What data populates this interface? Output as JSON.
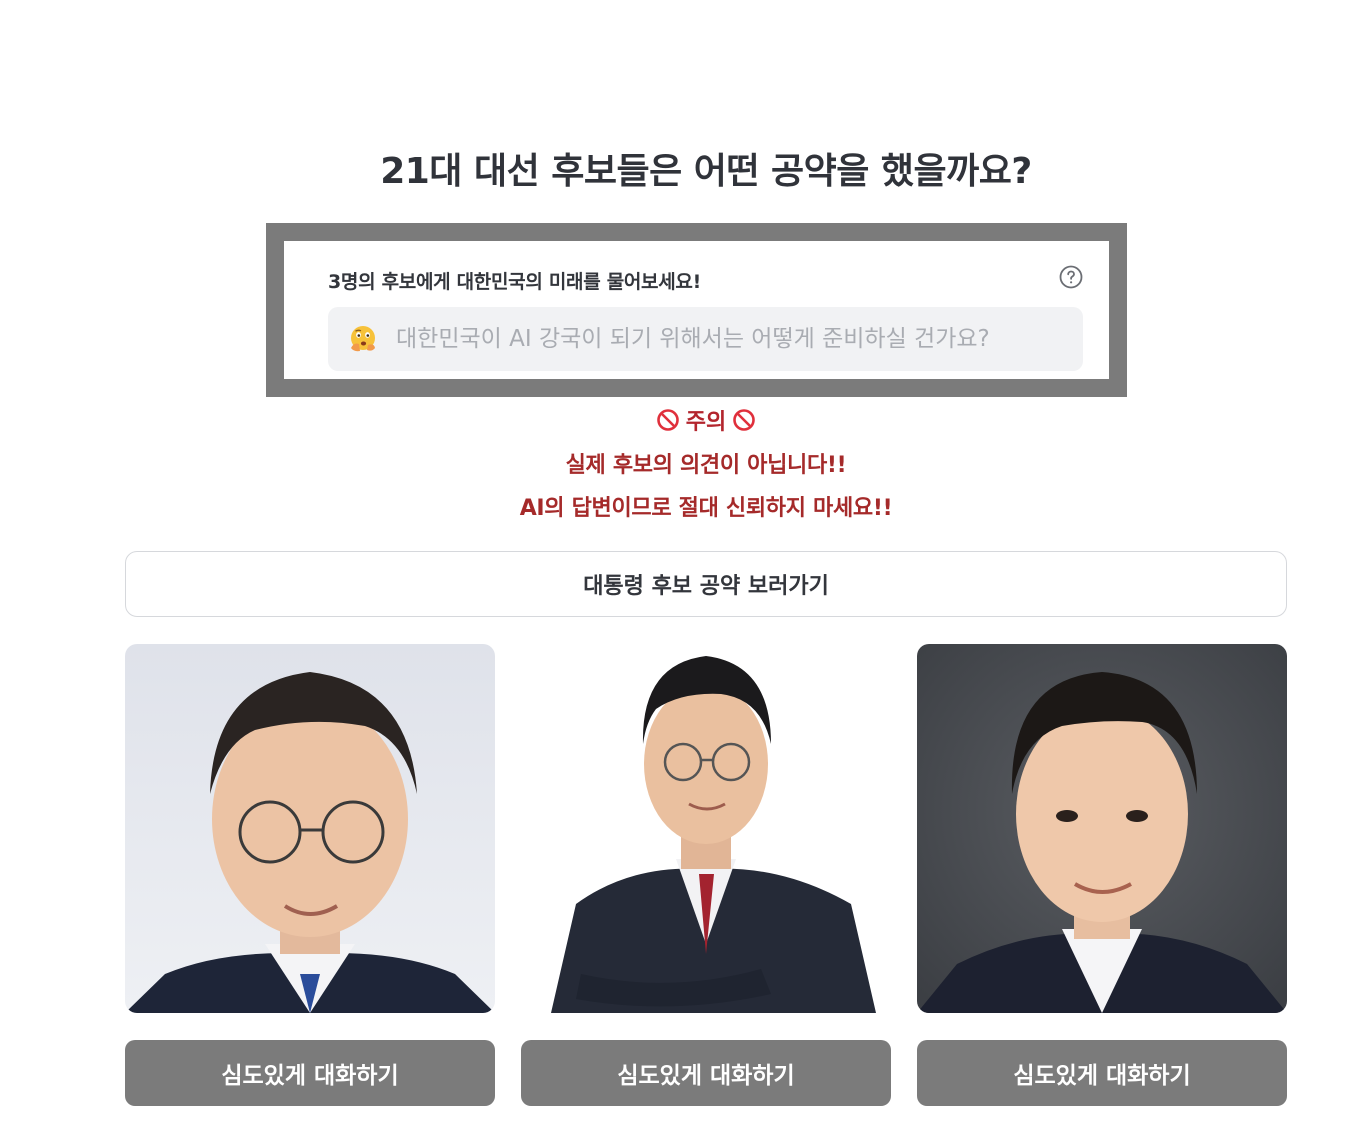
{
  "header": {
    "title": "21대 대선 후보들은 어떤 공약을 했을까요?"
  },
  "ask": {
    "label": "3명의 후보에게 대한민국의 미래를 물어보세요!",
    "placeholder": "대한민국이 AI 강국이 되기 위해서는 어떻게 준비하실 건가요?",
    "emoji": "thinking-face-icon",
    "help_icon": "question-circle-icon"
  },
  "warning": {
    "title": "주의",
    "icon": "prohibited-icon",
    "line1": "실제 후보의 의견이 아닙니다!!",
    "line2": "AI의 답변이므로 절대 신뢰하지 마세요!!",
    "color": "#a52a2a"
  },
  "pledge_button": {
    "label": "대통령 후보 공약 보러가기"
  },
  "candidates": [
    {
      "photo": "candidate-portrait",
      "button_label": "심도있게 대화하기"
    },
    {
      "photo": "candidate-portrait",
      "button_label": "심도있게 대화하기"
    },
    {
      "photo": "candidate-portrait",
      "button_label": "심도있게 대화하기"
    }
  ],
  "colors": {
    "button_bg": "#7b7b7b",
    "frame": "#7b7b7b",
    "input_bg": "#f1f2f4"
  }
}
